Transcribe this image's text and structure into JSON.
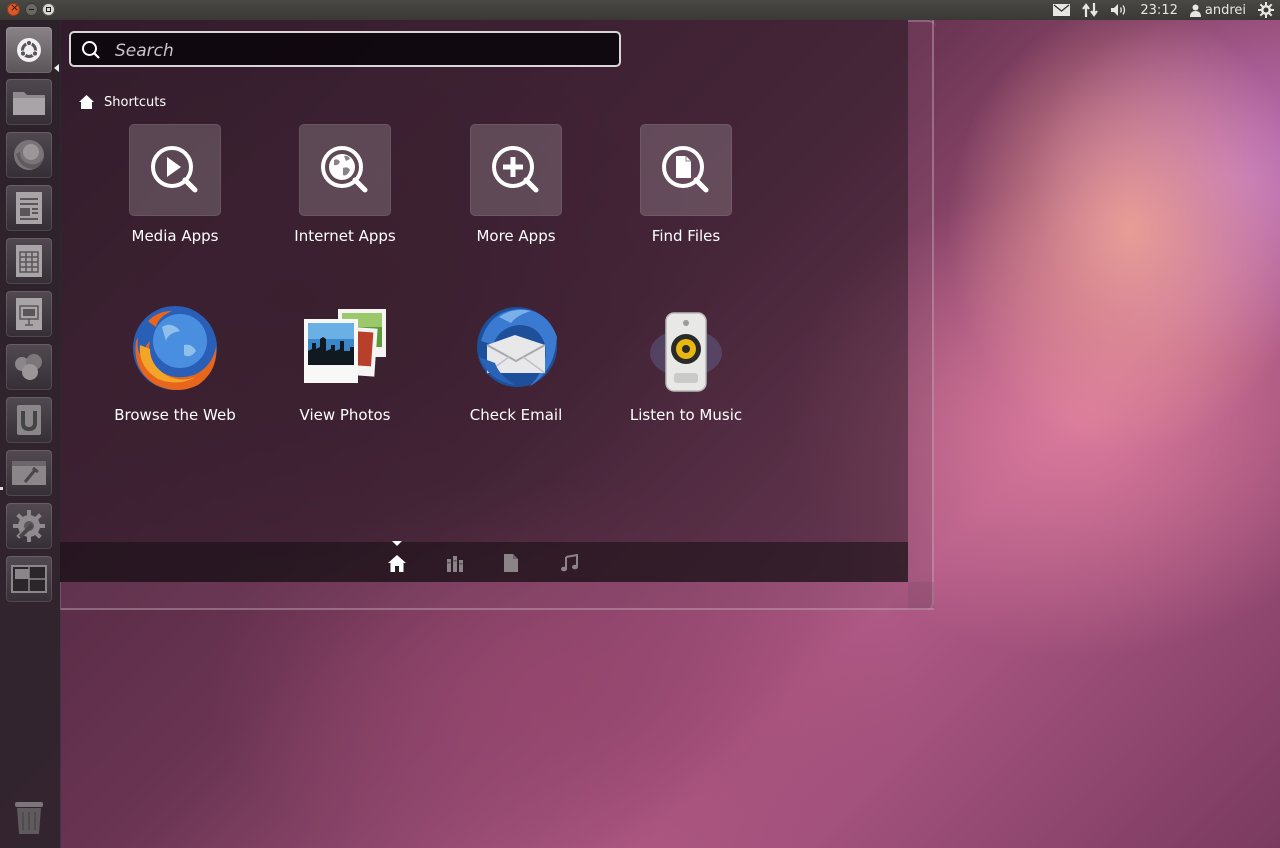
{
  "panel": {
    "time": "23:12",
    "user": "andrei",
    "indicators": [
      "mail-icon",
      "network-icon",
      "volume-icon",
      "user-icon",
      "session-gear-icon"
    ]
  },
  "launcher": {
    "items": [
      "dash-home-icon",
      "files-folder-icon",
      "firefox-icon",
      "writer-icon",
      "calc-icon",
      "impress-icon",
      "shotwell-icon",
      "ubuntu-software-icon",
      "workspace-tools-icon",
      "system-settings-icon",
      "workspace-switcher-icon",
      "trash-icon"
    ]
  },
  "dash": {
    "search": {
      "placeholder": "Search"
    },
    "section_title": "Shortcuts",
    "shortcuts": [
      {
        "label": "Media Apps",
        "icon": "media-apps-icon"
      },
      {
        "label": "Internet Apps",
        "icon": "internet-apps-icon"
      },
      {
        "label": "More Apps",
        "icon": "more-apps-icon"
      },
      {
        "label": "Find Files",
        "icon": "find-files-icon"
      }
    ],
    "apps": [
      {
        "label": "Browse the Web",
        "icon": "firefox-icon"
      },
      {
        "label": "View Photos",
        "icon": "photos-icon"
      },
      {
        "label": "Check Email",
        "icon": "thunderbird-icon"
      },
      {
        "label": "Listen to Music",
        "icon": "music-speaker-icon"
      }
    ],
    "lenses": [
      "home-lens-icon",
      "applications-lens-icon",
      "files-lens-icon",
      "music-lens-icon"
    ],
    "active_lens": "home-lens-icon"
  },
  "colors": {
    "accent_orange": "#d85a2a",
    "panel_bg": "#3a3935",
    "search_border": "#d9d5d8"
  }
}
